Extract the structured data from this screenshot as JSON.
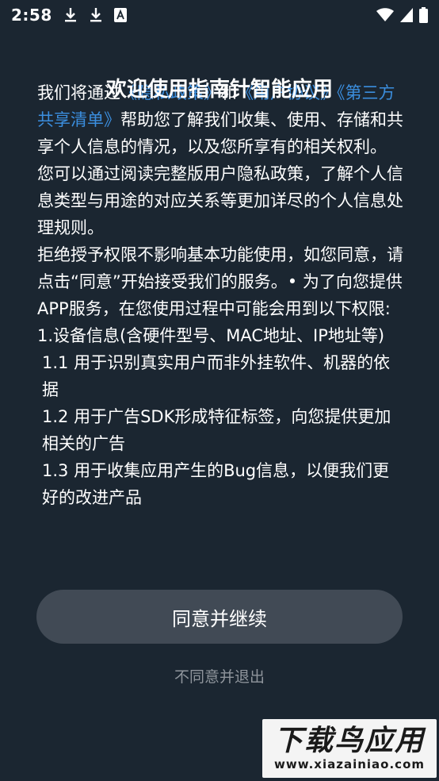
{
  "status_bar": {
    "time": "2:58",
    "left_icons": [
      "download-icon",
      "download-icon",
      "font-icon"
    ],
    "right_icons": [
      "wifi-icon",
      "signal-icon",
      "battery-icon"
    ]
  },
  "dialog": {
    "title": "欢迎使用指南针智能应用",
    "intro_prefix": "我们将通过",
    "link_1": "《隐私政策》",
    "intro_and": "和",
    "link_2": "《用户协议》",
    "link_3": "《第三方共享清单》",
    "intro_suffix": "帮助您了解我们收集、使用、存储和共享个人信息的情况，以及您所享有的相关权利。",
    "para_2": "您可以通过阅读完整版用户隐私政策，了解个人信息类型与用途的对应关系等更加详尽的个人信息处理规则。",
    "para_3": "拒绝授予权限不影响基本功能使用，如您同意，请点击“同意”开始接受我们的服务。• 为了向您提供APP服务，在您使用过程中可能会用到以下权限:",
    "item_1": "1.设备信息(含硬件型号、MAC地址、IP地址等)",
    "item_1_1": "1.1 用于识别真实用户而非外挂软件、机器的依据",
    "item_1_2": "1.2 用于广告SDK形成特征标签，向您提供更加相关的广告",
    "item_1_3": "1.3 用于收集应用产生的Bug信息，以便我们更好的改进产品",
    "agree_label": "同意并继续",
    "disagree_label": "不同意并退出"
  },
  "watermark": {
    "logo": "下载鸟应用",
    "url": "www.xiazainiao.com"
  },
  "colors": {
    "background": "#1b2631",
    "link": "#3b8ede",
    "button": "#414a55",
    "muted_text": "#8f959c"
  }
}
